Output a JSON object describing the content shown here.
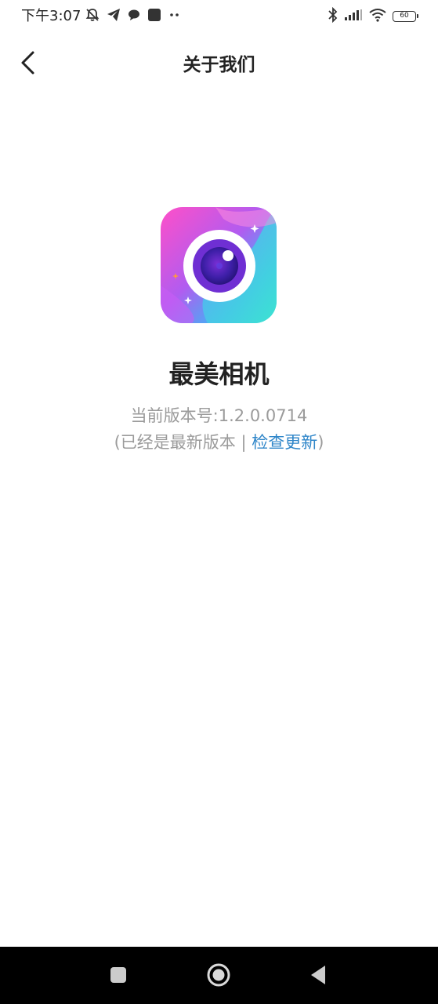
{
  "status_bar": {
    "time": "下午3:07",
    "battery_level": "60",
    "icons": [
      "mute-icon",
      "telegram-icon",
      "chat-bubble-icon",
      "app-square-icon",
      "more-dots-icon",
      "bluetooth-icon",
      "signal-icon",
      "wifi-icon",
      "battery-icon"
    ]
  },
  "header": {
    "title": "关于我们",
    "back_icon": "chevron-left-icon"
  },
  "app": {
    "name": "最美相机",
    "version_label": "当前版本号:1.2.0.0714",
    "update_prefix": "(已经是最新版本 | ",
    "check_update": "检查更新",
    "update_suffix": ")"
  },
  "colors": {
    "link": "#2f86c9",
    "secondary_text": "#9b9b9b",
    "primary_text": "#222222",
    "nav_bar": "#000000"
  },
  "nav": {
    "icons": [
      "recents-square-icon",
      "home-circle-icon",
      "back-triangle-icon"
    ]
  }
}
